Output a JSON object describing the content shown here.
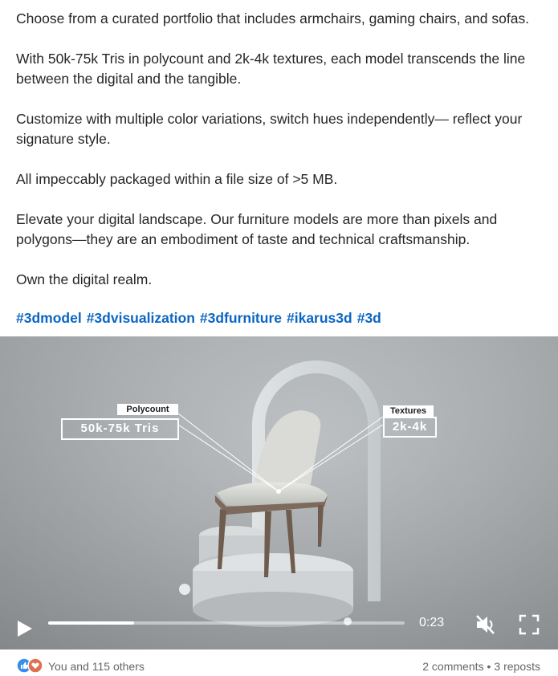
{
  "post": {
    "paragraphs": [
      "Choose from a curated portfolio that includes armchairs, gaming chairs, and sofas.",
      "With 50k-75k Tris in polycount and 2k-4k textures, each model transcends the line between the digital and the tangible.",
      "Customize with multiple color variations, switch hues independently— reflect your signature style.",
      "All impeccably packaged within a file size of >5 MB.",
      "Elevate your digital landscape. Our furniture models are more than pixels and polygons—they are an embodiment of taste and technical craftsmanship.",
      "Own the digital realm."
    ],
    "hashtags": [
      "#3dmodel",
      "#3dvisualization",
      "#3dfurniture",
      "#ikarus3d",
      "#3d"
    ]
  },
  "video": {
    "callouts": {
      "polycount": {
        "label": "Polycount",
        "value": "50k-75k Tris"
      },
      "textures": {
        "label": "Textures",
        "value": "2k-4k"
      }
    },
    "controls": {
      "time": "0:23",
      "progress": 0.24,
      "muted": true
    },
    "icons": {
      "play": "play-icon",
      "mute": "muted-speaker-icon",
      "fullscreen": "fullscreen-icon"
    }
  },
  "social": {
    "reactions_text": "You and 115 others",
    "comments": "2 comments",
    "separator": "•",
    "reposts": "3 reposts",
    "colors": {
      "like": "#378fe9",
      "love": "#df704d",
      "link": "#0a66c2"
    }
  }
}
